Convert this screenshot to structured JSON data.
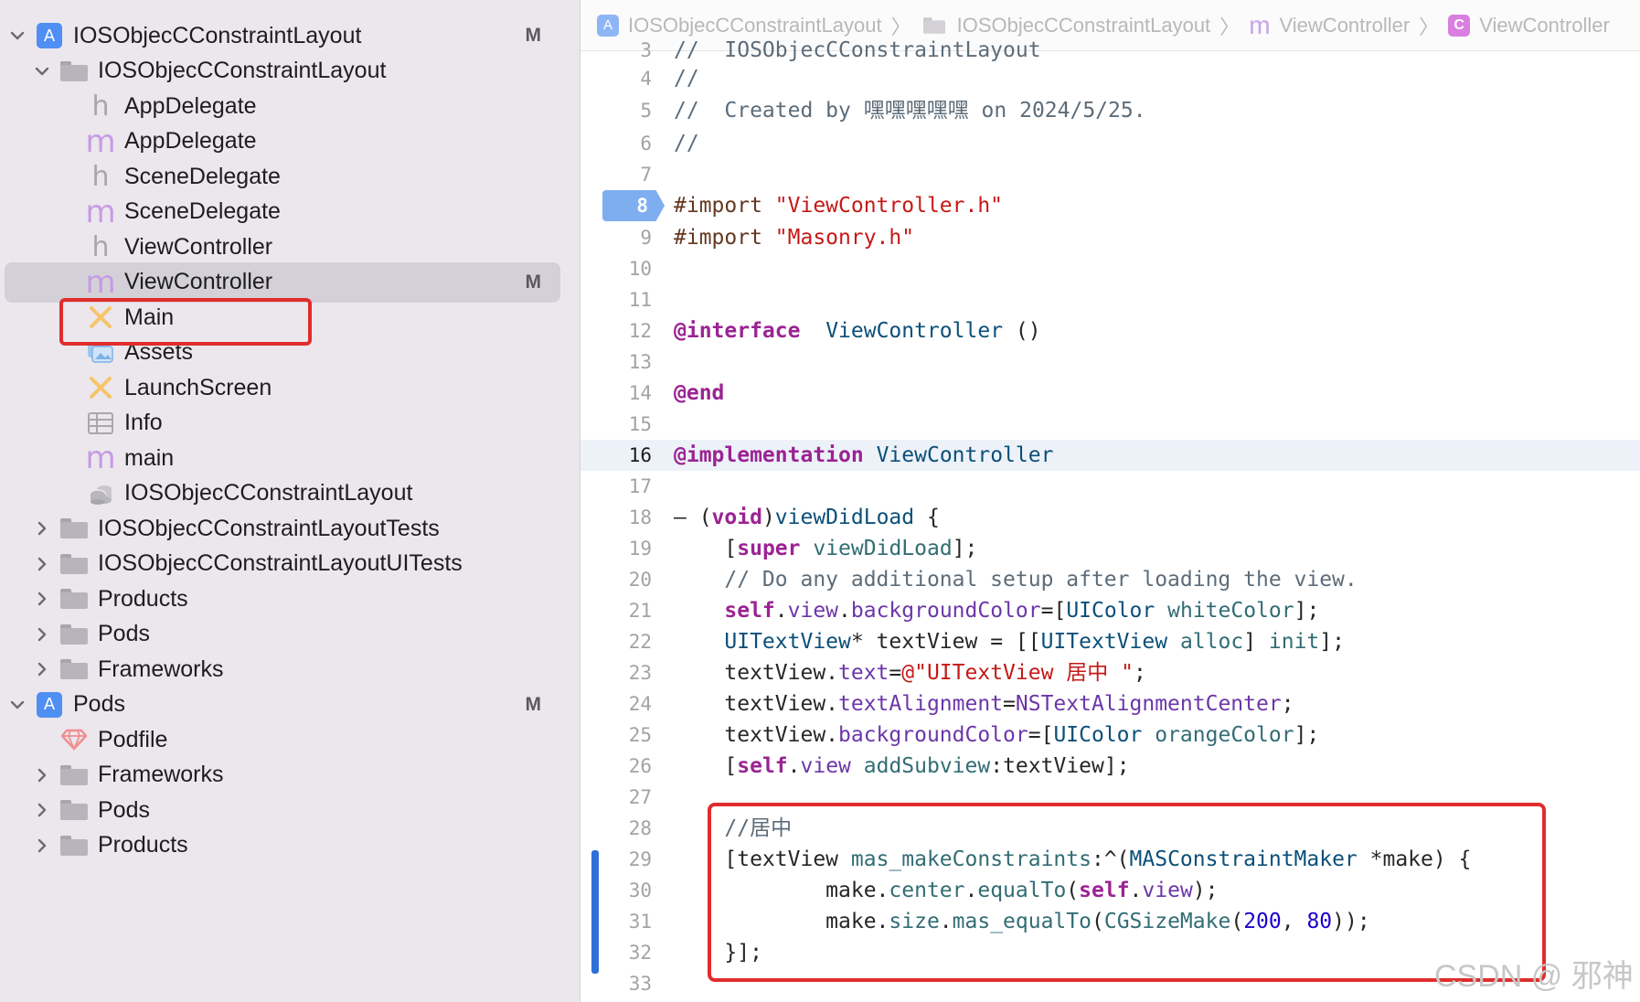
{
  "sidebar": {
    "items": [
      {
        "label": "IOSObjecCConstraintLayout",
        "icon": "project-icon",
        "disclosure": "open",
        "badge": "M"
      },
      {
        "label": "IOSObjecCConstraintLayout",
        "icon": "folder-icon",
        "disclosure": "open",
        "badge": ""
      },
      {
        "label": "AppDelegate",
        "icon": "header-file-icon",
        "disclosure": "",
        "badge": ""
      },
      {
        "label": "AppDelegate",
        "icon": "objc-file-icon",
        "disclosure": "",
        "badge": ""
      },
      {
        "label": "SceneDelegate",
        "icon": "header-file-icon",
        "disclosure": "",
        "badge": ""
      },
      {
        "label": "SceneDelegate",
        "icon": "objc-file-icon",
        "disclosure": "",
        "badge": ""
      },
      {
        "label": "ViewController",
        "icon": "header-file-icon",
        "disclosure": "",
        "badge": ""
      },
      {
        "label": "ViewController",
        "icon": "objc-file-icon",
        "disclosure": "",
        "badge": "M",
        "selected": true
      },
      {
        "label": "Main",
        "icon": "storyboard-icon",
        "disclosure": "",
        "badge": ""
      },
      {
        "label": "Assets",
        "icon": "assets-icon",
        "disclosure": "",
        "badge": ""
      },
      {
        "label": "LaunchScreen",
        "icon": "storyboard-icon",
        "disclosure": "",
        "badge": ""
      },
      {
        "label": "Info",
        "icon": "plist-icon",
        "disclosure": "",
        "badge": ""
      },
      {
        "label": "main",
        "icon": "objc-file-icon",
        "disclosure": "",
        "badge": ""
      },
      {
        "label": "IOSObjecCConstraintLayout",
        "icon": "data-model-icon",
        "disclosure": "",
        "badge": ""
      },
      {
        "label": "IOSObjecCConstraintLayoutTests",
        "icon": "folder-icon",
        "disclosure": "closed",
        "badge": ""
      },
      {
        "label": "IOSObjecCConstraintLayoutUITests",
        "icon": "folder-icon",
        "disclosure": "closed",
        "badge": ""
      },
      {
        "label": "Products",
        "icon": "folder-icon",
        "disclosure": "closed",
        "badge": ""
      },
      {
        "label": "Pods",
        "icon": "folder-icon",
        "disclosure": "closed",
        "badge": ""
      },
      {
        "label": "Frameworks",
        "icon": "folder-icon",
        "disclosure": "closed",
        "badge": ""
      },
      {
        "label": "Pods",
        "icon": "project-icon",
        "disclosure": "open",
        "badge": "M"
      },
      {
        "label": "Podfile",
        "icon": "podfile-icon",
        "disclosure": "",
        "badge": ""
      },
      {
        "label": "Frameworks",
        "icon": "folder-icon",
        "disclosure": "closed",
        "badge": ""
      },
      {
        "label": "Pods",
        "icon": "folder-icon",
        "disclosure": "closed",
        "badge": ""
      },
      {
        "label": "Products",
        "icon": "folder-icon",
        "disclosure": "closed",
        "badge": ""
      }
    ]
  },
  "jumpbar": {
    "crumbs": [
      {
        "label": "IOSObjecCConstraintLayout",
        "icon": "project-icon"
      },
      {
        "label": "IOSObjecCConstraintLayout",
        "icon": "folder-icon"
      },
      {
        "label": "ViewController",
        "icon": "objc-file-icon",
        "glyph": "m"
      },
      {
        "label": "ViewController",
        "icon": "class-icon",
        "glyph": "C"
      }
    ]
  },
  "editor": {
    "current_line": 16,
    "breakpoint_line": 8,
    "lines": [
      {
        "n": "3",
        "segs": [
          [
            "c",
            "//  IOSObjecCConstraintLayout"
          ]
        ]
      },
      {
        "n": "4",
        "segs": [
          [
            "c",
            "//"
          ]
        ]
      },
      {
        "n": "5",
        "segs": [
          [
            "c",
            "//  Created by 嘿嘿嘿嘿嘿 on 2024/5/25."
          ]
        ]
      },
      {
        "n": "6",
        "segs": [
          [
            "c",
            "//"
          ]
        ]
      },
      {
        "n": "7",
        "segs": []
      },
      {
        "n": "8",
        "segs": [
          [
            "pp",
            "#import "
          ],
          [
            "s",
            "\"ViewController.h\""
          ]
        ]
      },
      {
        "n": "9",
        "segs": [
          [
            "pp",
            "#import "
          ],
          [
            "s",
            "\"Masonry.h\""
          ]
        ]
      },
      {
        "n": "10",
        "segs": []
      },
      {
        "n": "11",
        "segs": []
      },
      {
        "n": "12",
        "segs": [
          [
            "k",
            "@interface"
          ],
          [
            "",
            "  "
          ],
          [
            "t",
            "ViewController"
          ],
          [
            "",
            " ()"
          ]
        ]
      },
      {
        "n": "13",
        "segs": []
      },
      {
        "n": "14",
        "segs": [
          [
            "k",
            "@end"
          ]
        ]
      },
      {
        "n": "15",
        "segs": []
      },
      {
        "n": "16",
        "segs": [
          [
            "k",
            "@implementation"
          ],
          [
            "",
            " "
          ],
          [
            "t",
            "ViewController"
          ]
        ]
      },
      {
        "n": "17",
        "segs": []
      },
      {
        "n": "18",
        "segs": [
          [
            "",
            "– ("
          ],
          [
            "k",
            "void"
          ],
          [
            "",
            ")"
          ],
          [
            "t",
            "viewDidLoad"
          ],
          [
            "",
            " {"
          ]
        ]
      },
      {
        "n": "19",
        "segs": [
          [
            "",
            "    ["
          ],
          [
            "k",
            "super"
          ],
          [
            "",
            " "
          ],
          [
            "m",
            "viewDidLoad"
          ],
          [
            "",
            "];"
          ]
        ]
      },
      {
        "n": "20",
        "segs": [
          [
            "",
            "    "
          ],
          [
            "c",
            "// Do any additional setup after loading the view."
          ]
        ]
      },
      {
        "n": "21",
        "segs": [
          [
            "",
            "    "
          ],
          [
            "k",
            "self"
          ],
          [
            "",
            "."
          ],
          [
            "p",
            "view"
          ],
          [
            "",
            "."
          ],
          [
            "p",
            "backgroundColor"
          ],
          [
            "",
            "=["
          ],
          [
            "t",
            "UIColor"
          ],
          [
            "",
            " "
          ],
          [
            "m",
            "whiteColor"
          ],
          [
            "",
            "];"
          ]
        ]
      },
      {
        "n": "22",
        "segs": [
          [
            "",
            "    "
          ],
          [
            "t",
            "UITextView"
          ],
          [
            "",
            "* textView = [["
          ],
          [
            "t",
            "UITextView"
          ],
          [
            "",
            " "
          ],
          [
            "m",
            "alloc"
          ],
          [
            "",
            "] "
          ],
          [
            "m",
            "init"
          ],
          [
            "",
            "];"
          ]
        ]
      },
      {
        "n": "23",
        "segs": [
          [
            "",
            "    textView."
          ],
          [
            "p",
            "text"
          ],
          [
            "",
            "="
          ],
          [
            "s",
            "@\"UITextView 居中 \""
          ],
          [
            "",
            ";"
          ]
        ]
      },
      {
        "n": "24",
        "segs": [
          [
            "",
            "    textView."
          ],
          [
            "p",
            "textAlignment"
          ],
          [
            "",
            "="
          ],
          [
            "p",
            "NSTextAlignmentCenter"
          ],
          [
            "",
            ";"
          ]
        ]
      },
      {
        "n": "25",
        "segs": [
          [
            "",
            "    textView."
          ],
          [
            "p",
            "backgroundColor"
          ],
          [
            "",
            "=["
          ],
          [
            "t",
            "UIColor"
          ],
          [
            "",
            " "
          ],
          [
            "m",
            "orangeColor"
          ],
          [
            "",
            "];"
          ]
        ]
      },
      {
        "n": "26",
        "segs": [
          [
            "",
            "    ["
          ],
          [
            "k",
            "self"
          ],
          [
            "",
            "."
          ],
          [
            "p",
            "view"
          ],
          [
            "",
            " "
          ],
          [
            "m",
            "addSubview"
          ],
          [
            "",
            ":textView];"
          ]
        ]
      },
      {
        "n": "27",
        "segs": []
      },
      {
        "n": "28",
        "segs": [
          [
            "",
            "    "
          ],
          [
            "c",
            "//居中"
          ]
        ]
      },
      {
        "n": "29",
        "segs": [
          [
            "",
            "    [textView "
          ],
          [
            "m",
            "mas_makeConstraints"
          ],
          [
            "",
            ":^("
          ],
          [
            "t",
            "MASConstraintMaker"
          ],
          [
            "",
            " *make) {"
          ]
        ]
      },
      {
        "n": "30",
        "segs": [
          [
            "",
            "            make."
          ],
          [
            "m",
            "center"
          ],
          [
            "",
            "."
          ],
          [
            "m",
            "equalTo"
          ],
          [
            "",
            "("
          ],
          [
            "k",
            "self"
          ],
          [
            "",
            "."
          ],
          [
            "p",
            "view"
          ],
          [
            "",
            ");"
          ]
        ]
      },
      {
        "n": "31",
        "segs": [
          [
            "",
            "            make."
          ],
          [
            "m",
            "size"
          ],
          [
            "",
            "."
          ],
          [
            "m",
            "mas_equalTo"
          ],
          [
            "",
            "("
          ],
          [
            "m",
            "CGSizeMake"
          ],
          [
            "",
            "("
          ],
          [
            "n",
            "200"
          ],
          [
            "",
            ", "
          ],
          [
            "n",
            "80"
          ],
          [
            "",
            "));"
          ]
        ]
      },
      {
        "n": "32",
        "segs": [
          [
            "",
            "    }];"
          ]
        ]
      },
      {
        "n": "33",
        "segs": []
      }
    ]
  },
  "watermark": "CSDN @  邪神"
}
